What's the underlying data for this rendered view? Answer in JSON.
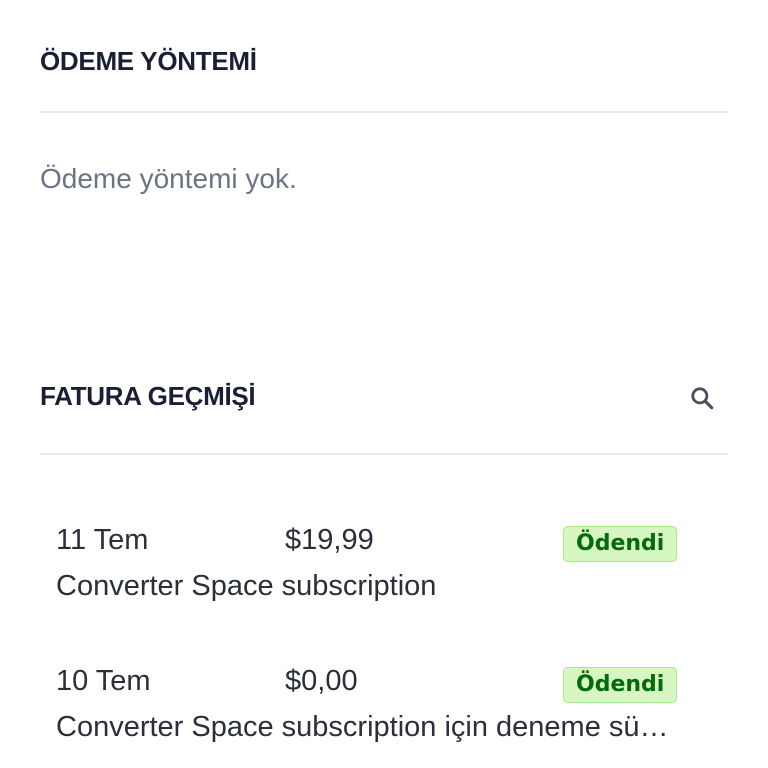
{
  "payment_method": {
    "title": "ÖDEME YÖNTEMİ",
    "empty_text": "Ödeme yöntemi yok."
  },
  "invoice_history": {
    "title": "FATURA GEÇMİŞİ",
    "search_icon": "search-icon",
    "invoices": [
      {
        "date": "11 Tem",
        "amount": "$19,99",
        "status": "Ödendi",
        "description": "Converter Space subscription"
      },
      {
        "date": "10 Tem",
        "amount": "$0,00",
        "status": "Ödendi",
        "description": "Converter Space subscription için deneme sü…"
      }
    ]
  },
  "colors": {
    "badge_bg": "#d7f7c2",
    "badge_text": "#05690d",
    "muted_text": "#6b7385"
  }
}
